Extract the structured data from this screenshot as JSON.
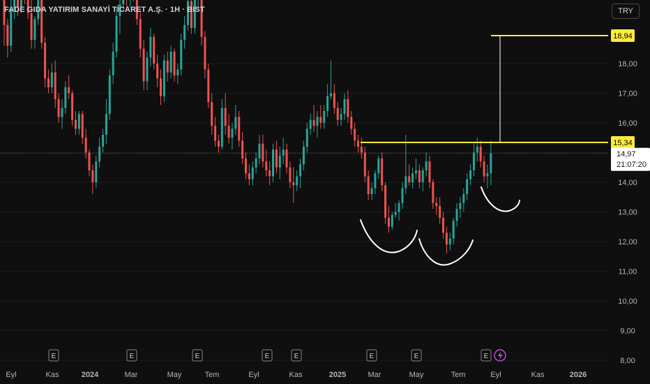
{
  "header": {
    "title": "FADE GIDA YATIRIM SANAYİ TİCARET A.Ş. · 1H · BIST",
    "currency_label": "TRY"
  },
  "colors": {
    "background": "#0f0f0f",
    "up": "#26a69a",
    "down": "#ef5350",
    "grid": "#1c1c1c",
    "axis_text": "#b2b5be",
    "yellow_line": "#ffeb3b",
    "target_line": "#e0e0e0",
    "price_line": "#ef5350",
    "drawing": "#ffffff"
  },
  "chart_data": {
    "type": "candlestick",
    "ylim": [
      7.8,
      20.9
    ],
    "y_ticks": [
      "8,00",
      "9,00",
      "10,00",
      "11,00",
      "12,00",
      "13,00",
      "14,00",
      "15,00",
      "16,00",
      "17,00",
      "18,00"
    ],
    "x_ticks": [
      "Eyl",
      "Kas",
      "2024",
      "Mar",
      "May",
      "Tem",
      "Eyl",
      "Kas",
      "2025",
      "Mar",
      "May",
      "Tem",
      "Eyl",
      "Kas",
      "2026"
    ],
    "earnings_markers": [
      "E",
      "E",
      "E",
      "E",
      "E",
      "E",
      "E",
      "E"
    ],
    "dividend_icon": "lightning-icon",
    "levels": [
      {
        "name": "target",
        "price": 18.94,
        "label": "18,94"
      },
      {
        "name": "neckline",
        "price": 15.34,
        "label": "15,34"
      }
    ],
    "last_price": {
      "price": 14.97,
      "label": "14,97",
      "countdown": "21:07:20"
    },
    "patterns": [
      "cup",
      "cup",
      "cup"
    ],
    "candles": [
      [
        21.1,
        21.2,
        18.6,
        19.3
      ],
      [
        19.3,
        19.5,
        18.2,
        18.6
      ],
      [
        18.6,
        20.3,
        18.4,
        19.8
      ],
      [
        19.8,
        21.0,
        19.5,
        20.5
      ],
      [
        20.5,
        21.0,
        19.6,
        19.9
      ],
      [
        19.9,
        20.8,
        19.7,
        20.6
      ],
      [
        20.6,
        21.0,
        20.0,
        20.3
      ],
      [
        20.3,
        20.6,
        19.5,
        19.7
      ],
      [
        19.7,
        20.2,
        18.5,
        18.8
      ],
      [
        18.8,
        19.6,
        18.5,
        19.5
      ],
      [
        19.5,
        20.4,
        19.3,
        20.2
      ],
      [
        20.2,
        20.4,
        18.5,
        18.7
      ],
      [
        18.7,
        18.9,
        17.2,
        17.5
      ],
      [
        17.5,
        17.8,
        17.0,
        17.2
      ],
      [
        17.2,
        18.0,
        17.0,
        17.7
      ],
      [
        17.7,
        18.1,
        16.5,
        16.8
      ],
      [
        16.8,
        17.0,
        16.0,
        16.2
      ],
      [
        16.2,
        16.8,
        15.8,
        16.5
      ],
      [
        16.5,
        17.4,
        16.3,
        17.2
      ],
      [
        17.2,
        17.6,
        16.8,
        17.0
      ],
      [
        17.0,
        17.1,
        15.9,
        16.1
      ],
      [
        16.1,
        16.4,
        15.6,
        15.8
      ],
      [
        15.8,
        16.4,
        15.6,
        16.3
      ],
      [
        16.3,
        16.4,
        15.3,
        15.5
      ],
      [
        15.5,
        15.8,
        14.8,
        15.0
      ],
      [
        15.0,
        15.1,
        14.2,
        14.4
      ],
      [
        14.4,
        14.6,
        13.6,
        14.0
      ],
      [
        14.0,
        14.9,
        13.8,
        14.7
      ],
      [
        14.7,
        15.5,
        14.5,
        15.2
      ],
      [
        15.2,
        15.8,
        15.0,
        15.6
      ],
      [
        15.6,
        16.8,
        15.3,
        16.3
      ],
      [
        16.3,
        17.8,
        16.1,
        17.6
      ],
      [
        17.6,
        18.7,
        17.3,
        18.4
      ],
      [
        18.4,
        19.9,
        18.2,
        19.6
      ],
      [
        19.6,
        20.6,
        19.0,
        20.0
      ],
      [
        20.0,
        20.9,
        19.8,
        20.6
      ],
      [
        20.6,
        20.8,
        19.8,
        20.2
      ],
      [
        20.2,
        20.6,
        19.9,
        20.4
      ],
      [
        20.4,
        20.9,
        20.1,
        20.7
      ],
      [
        20.7,
        20.9,
        19.3,
        19.5
      ],
      [
        19.5,
        19.8,
        18.2,
        18.5
      ],
      [
        18.5,
        18.8,
        17.1,
        17.4
      ],
      [
        17.4,
        18.4,
        17.1,
        18.2
      ],
      [
        18.2,
        19.2,
        17.9,
        18.9
      ],
      [
        18.9,
        19.0,
        17.8,
        18.0
      ],
      [
        18.0,
        18.3,
        17.2,
        17.5
      ],
      [
        17.5,
        17.8,
        16.6,
        16.9
      ],
      [
        16.9,
        18.3,
        16.7,
        18.1
      ],
      [
        18.1,
        18.4,
        17.4,
        17.7
      ],
      [
        17.7,
        18.6,
        17.5,
        18.4
      ],
      [
        18.4,
        18.5,
        17.4,
        17.6
      ],
      [
        17.6,
        18.0,
        17.3,
        17.8
      ],
      [
        17.8,
        19.0,
        17.6,
        18.8
      ],
      [
        18.8,
        19.6,
        18.5,
        19.3
      ],
      [
        19.3,
        20.4,
        19.1,
        20.1
      ],
      [
        20.1,
        20.3,
        19.0,
        19.2
      ],
      [
        19.2,
        20.5,
        19.0,
        20.3
      ],
      [
        20.3,
        20.9,
        19.8,
        20.6
      ],
      [
        20.6,
        20.8,
        18.6,
        18.9
      ],
      [
        18.9,
        19.1,
        17.5,
        17.8
      ],
      [
        17.8,
        18.0,
        16.5,
        16.7
      ],
      [
        16.7,
        17.0,
        15.6,
        15.9
      ],
      [
        15.9,
        16.2,
        15.2,
        15.4
      ],
      [
        15.4,
        15.6,
        15.0,
        15.2
      ],
      [
        15.2,
        16.8,
        15.1,
        16.5
      ],
      [
        16.5,
        17.0,
        15.6,
        15.9
      ],
      [
        15.9,
        16.3,
        15.3,
        15.5
      ],
      [
        15.5,
        16.0,
        15.1,
        15.8
      ],
      [
        15.8,
        16.6,
        15.6,
        16.2
      ],
      [
        16.2,
        16.4,
        15.2,
        15.4
      ],
      [
        15.4,
        15.7,
        14.6,
        14.8
      ],
      [
        14.8,
        15.0,
        14.1,
        14.3
      ],
      [
        14.3,
        14.6,
        13.9,
        14.1
      ],
      [
        14.1,
        14.7,
        13.9,
        14.5
      ],
      [
        14.5,
        15.0,
        14.3,
        14.8
      ],
      [
        14.8,
        15.6,
        14.6,
        15.3
      ],
      [
        15.3,
        15.6,
        14.5,
        14.7
      ],
      [
        14.7,
        15.1,
        14.2,
        14.4
      ],
      [
        14.4,
        14.7,
        13.9,
        14.2
      ],
      [
        14.2,
        15.3,
        14.0,
        15.1
      ],
      [
        15.1,
        15.4,
        14.3,
        14.5
      ],
      [
        14.5,
        15.2,
        14.1,
        14.9
      ],
      [
        14.9,
        15.5,
        14.6,
        15.1
      ],
      [
        15.1,
        15.3,
        14.3,
        14.5
      ],
      [
        14.5,
        14.7,
        13.8,
        14.0
      ],
      [
        14.0,
        14.5,
        13.3,
        13.9
      ],
      [
        13.9,
        14.4,
        13.7,
        14.2
      ],
      [
        14.2,
        14.8,
        13.8,
        14.6
      ],
      [
        14.6,
        15.4,
        14.4,
        15.2
      ],
      [
        15.2,
        16.0,
        15.0,
        15.8
      ],
      [
        15.8,
        16.3,
        15.6,
        16.1
      ],
      [
        16.1,
        16.6,
        15.7,
        15.9
      ],
      [
        15.9,
        16.4,
        15.5,
        16.2
      ],
      [
        16.2,
        16.6,
        15.8,
        16.0
      ],
      [
        16.0,
        16.6,
        15.8,
        16.4
      ],
      [
        16.4,
        17.3,
        16.2,
        16.9
      ],
      [
        16.9,
        18.1,
        16.8,
        17.0
      ],
      [
        17.0,
        17.3,
        16.3,
        16.5
      ],
      [
        16.5,
        16.7,
        15.9,
        16.1
      ],
      [
        16.1,
        16.5,
        15.9,
        16.3
      ],
      [
        16.3,
        17.0,
        16.1,
        16.8
      ],
      [
        16.8,
        17.1,
        16.0,
        16.2
      ],
      [
        16.2,
        16.4,
        15.6,
        15.8
      ],
      [
        15.8,
        16.0,
        15.2,
        15.4
      ],
      [
        15.4,
        15.6,
        15.0,
        15.2
      ],
      [
        15.2,
        15.5,
        14.8,
        15.0
      ],
      [
        15.0,
        15.2,
        14.0,
        14.2
      ],
      [
        14.2,
        14.4,
        13.4,
        13.6
      ],
      [
        13.6,
        14.0,
        13.4,
        13.8
      ],
      [
        13.8,
        14.4,
        13.6,
        14.3
      ],
      [
        14.3,
        14.9,
        14.1,
        14.8
      ],
      [
        14.8,
        15.0,
        13.7,
        13.9
      ],
      [
        13.9,
        14.0,
        12.6,
        12.8
      ],
      [
        12.8,
        13.2,
        12.3,
        12.5
      ],
      [
        12.5,
        13.0,
        12.4,
        12.9
      ],
      [
        12.9,
        13.3,
        12.8,
        13.0
      ],
      [
        13.0,
        13.4,
        12.7,
        13.3
      ],
      [
        13.3,
        14.0,
        13.1,
        13.8
      ],
      [
        13.8,
        15.6,
        13.6,
        14.2
      ],
      [
        14.2,
        14.6,
        13.9,
        14.0
      ],
      [
        14.0,
        14.5,
        13.8,
        14.3
      ],
      [
        14.3,
        14.8,
        14.1,
        14.4
      ],
      [
        14.4,
        14.6,
        13.8,
        14.0
      ],
      [
        14.0,
        14.5,
        13.7,
        14.4
      ],
      [
        14.4,
        15.0,
        14.2,
        14.7
      ],
      [
        14.7,
        14.9,
        13.8,
        14.0
      ],
      [
        14.0,
        14.1,
        13.1,
        13.3
      ],
      [
        13.3,
        13.5,
        12.9,
        13.2
      ],
      [
        13.2,
        13.5,
        12.6,
        12.8
      ],
      [
        12.8,
        13.0,
        12.1,
        12.3
      ],
      [
        12.3,
        12.5,
        11.6,
        11.9
      ],
      [
        11.9,
        12.3,
        11.7,
        12.1
      ],
      [
        12.1,
        12.8,
        11.9,
        12.7
      ],
      [
        12.7,
        13.3,
        12.5,
        13.1
      ],
      [
        13.1,
        13.5,
        12.8,
        13.3
      ],
      [
        13.3,
        13.8,
        13.0,
        13.6
      ],
      [
        13.6,
        14.3,
        13.4,
        14.1
      ],
      [
        14.1,
        14.6,
        13.9,
        14.4
      ],
      [
        14.4,
        15.3,
        14.2,
        15.0
      ],
      [
        15.0,
        15.5,
        14.7,
        15.2
      ],
      [
        15.2,
        15.4,
        14.5,
        14.7
      ],
      [
        14.7,
        14.9,
        14.0,
        14.2
      ],
      [
        14.2,
        14.6,
        13.8,
        14.3
      ],
      [
        14.3,
        15.4,
        13.9,
        14.97
      ]
    ]
  }
}
